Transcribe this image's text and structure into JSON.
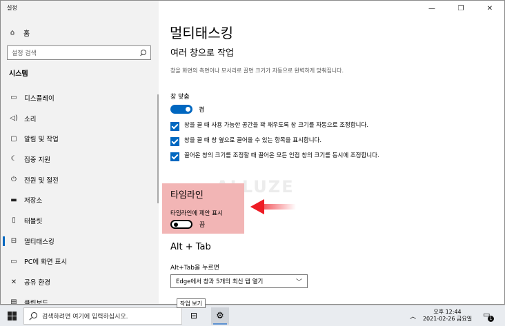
{
  "app": {
    "title": "설정"
  },
  "sidebar": {
    "home_label": "홈",
    "search_placeholder": "설정 검색",
    "section_title": "시스템",
    "items": [
      {
        "label": "디스플레이",
        "icon": "display-icon"
      },
      {
        "label": "소리",
        "icon": "speaker-icon"
      },
      {
        "label": "알림 및 작업",
        "icon": "notification-icon"
      },
      {
        "label": "집중 지원",
        "icon": "moon-icon"
      },
      {
        "label": "전원 및 절전",
        "icon": "power-icon"
      },
      {
        "label": "저장소",
        "icon": "storage-icon"
      },
      {
        "label": "태블릿",
        "icon": "tablet-icon"
      },
      {
        "label": "멀티태스킹",
        "icon": "multitasking-icon",
        "active": true
      },
      {
        "label": "PC에 화면 표시",
        "icon": "project-icon"
      },
      {
        "label": "공유 환경",
        "icon": "share-icon"
      },
      {
        "label": "클립보드",
        "icon": "clipboard-icon"
      }
    ]
  },
  "main": {
    "page_title": "멀티태스킹",
    "snap_section_title": "여러 창으로 작업",
    "snap_description": "창을 화면의 측면이나 모서리로 끌면 크기가 자동으로 완벽하게 맞춰집니다.",
    "snap_label": "창 맞춤",
    "snap_state": "켬",
    "snap_on": true,
    "checkboxes": [
      {
        "label": "창을 끌 때 사용 가능한 공간을 꽉 채우도록 창 크기를 자동으로 조정합니다.",
        "checked": true
      },
      {
        "label": "창을 끌 때 창 옆으로 끌어올 수 있는 항목을 표시합니다.",
        "checked": true
      },
      {
        "label": "끌어온 창의 크기를 조정할 때 끌어온 모든 인접 창의 크기를 동시에 조정합니다.",
        "checked": true
      }
    ],
    "timeline_title": "타임라인",
    "timeline_label": "타임라인에 제안 표시",
    "timeline_state": "끔",
    "timeline_on": false,
    "alttab_title": "Alt + Tab",
    "alttab_label": "Alt+Tab을 누르면",
    "alttab_value": "Edge에서 창과 5개의 최신 탭 열기"
  },
  "watermark": "ALLUZE",
  "tooltip": "작업 보기",
  "taskbar": {
    "search_placeholder": "검색하려면 여기에 입력하십시오.",
    "time": "오후 12:44",
    "date": "2021-02-26 금요일",
    "notification_count": "1"
  },
  "colors": {
    "accent": "#0067c0",
    "highlight": "#f2b5b5",
    "arrow": "#ee1c25"
  }
}
